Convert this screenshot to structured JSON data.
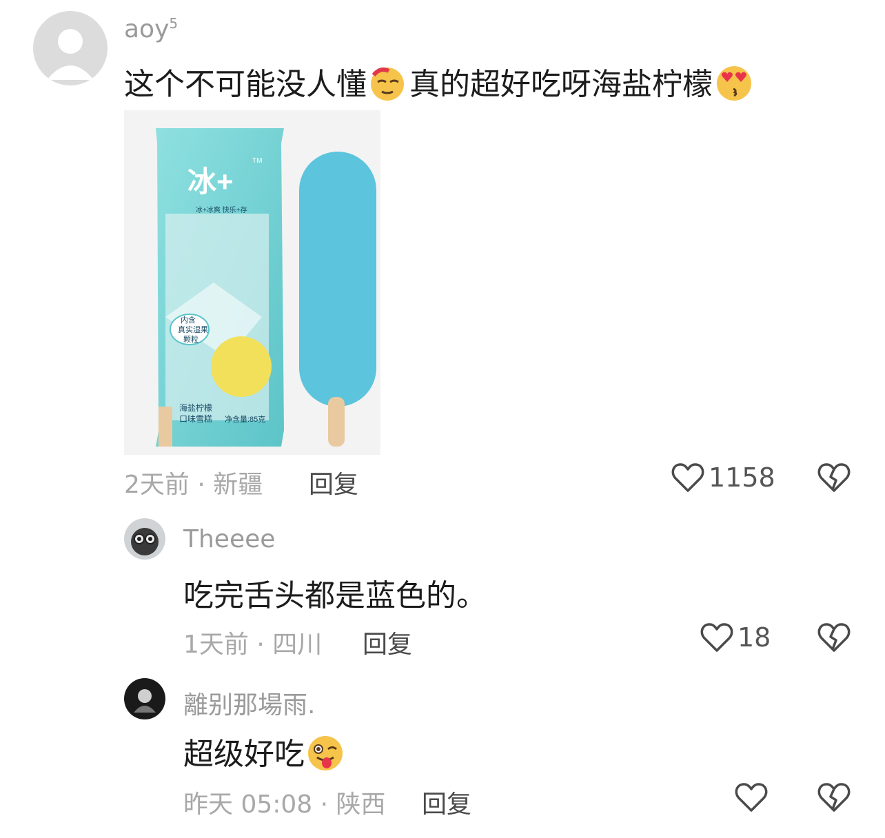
{
  "comments": [
    {
      "username": "aoy",
      "username_badge": "5",
      "text_parts": [
        "这个不可能没人懂",
        "真的超好吃呀海盐柠檬"
      ],
      "emojis": [
        "dizzy-smirk-emoji",
        "heart-eyes-kiss-emoji"
      ],
      "time_location": "2天前 · 新疆",
      "reply_label": "回复",
      "like_count": "1158",
      "image": {
        "brand": "冰+",
        "trademark": "TM",
        "slogan": "冰+冰爽 快乐+存",
        "badge_lines": [
          "内含",
          "真实湿果",
          "颗粒"
        ],
        "flavor_lines": [
          "海盐柠檬",
          "口味雪糕"
        ],
        "net_weight": "净含量:85克",
        "colors": {
          "wrapper": "#7fd4d4",
          "popsicle": "#5cc4dc",
          "lemon": "#f2e05a",
          "stick": "#e8c9a0"
        }
      }
    },
    {
      "username": "Theeee",
      "text": "吃完舌头都是蓝色的。",
      "time_location": "1天前 · 四川",
      "reply_label": "回复",
      "like_count": "18"
    },
    {
      "username": "離别那場雨.",
      "text": "超级好吃",
      "emojis": [
        "tongue-wink-emoji"
      ],
      "time_location": "昨天 05:08 · 陕西",
      "reply_label": "回复",
      "like_count": ""
    }
  ]
}
